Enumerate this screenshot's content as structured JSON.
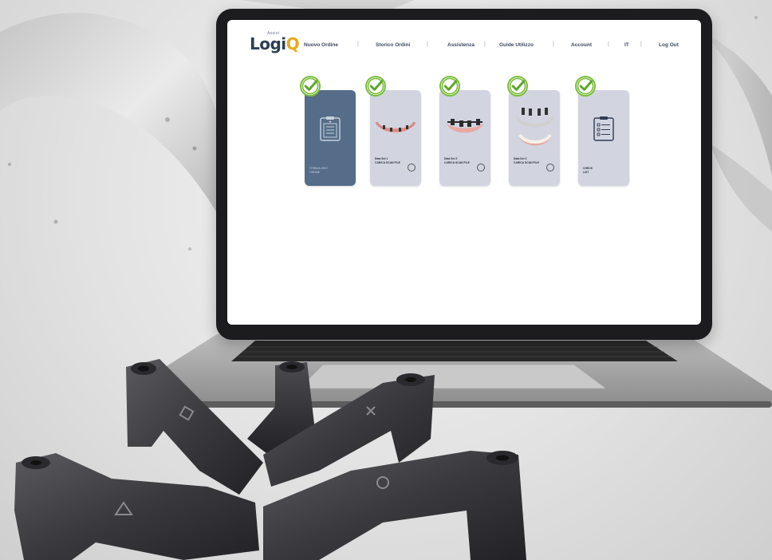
{
  "app": {
    "logo": {
      "prefix": "Assist",
      "name_main": "Logi",
      "name_accent": "Q"
    }
  },
  "nav": {
    "items": [
      "Nuovo Ordine",
      "Storico Ordini",
      "Assistenza",
      "Guide Utilizzo",
      "Account",
      "IT",
      "Log Out"
    ]
  },
  "steps": [
    {
      "title": "FORMULARIO",
      "subtitle": "ORDINE",
      "completed": true
    },
    {
      "title": "Data Set 1",
      "subtitle": "CARICA SCAN FILE",
      "completed": true
    },
    {
      "title": "Data Set 2",
      "subtitle": "CARICA SCAN FILE",
      "completed": true
    },
    {
      "title": "Data Set 3",
      "subtitle": "CARICA SCAN FILE",
      "completed": true
    },
    {
      "title": "CHECK",
      "subtitle": "LIST",
      "completed": true
    }
  ],
  "colors": {
    "nav_text": "#3c4a5e",
    "card_active": "#556d88",
    "card_default": "#d2d5e0",
    "check_green": "#7bbd3c",
    "logo_accent": "#e8a91c"
  }
}
